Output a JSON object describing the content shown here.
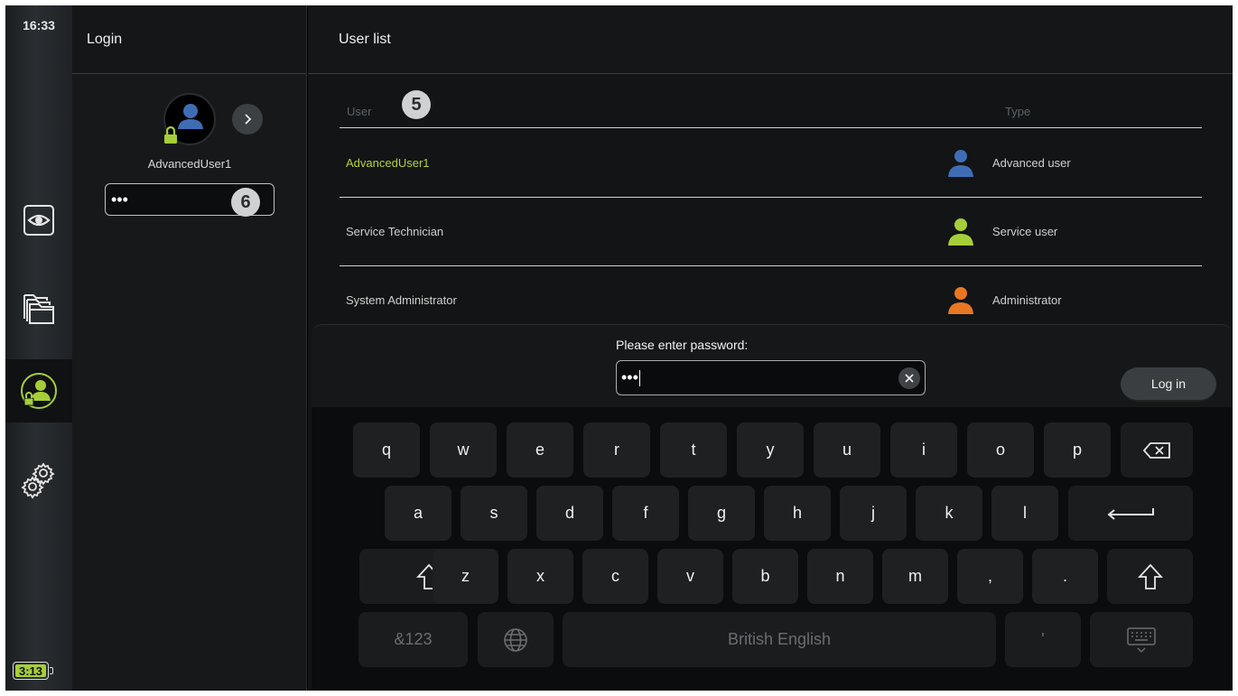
{
  "status": {
    "time": "16:33",
    "battery": "3:13"
  },
  "sidebar": {
    "items": [
      {
        "id": "eye",
        "icon": "eye-icon"
      },
      {
        "id": "folders",
        "icon": "folders-icon"
      },
      {
        "id": "login",
        "icon": "user-lock-icon",
        "active": true
      },
      {
        "id": "settings",
        "icon": "gears-icon"
      }
    ]
  },
  "login": {
    "title": "Login",
    "username": "AdvancedUser1",
    "password_mask": "•••",
    "callout": "6"
  },
  "user_list": {
    "title": "User list",
    "col_user": "User",
    "col_type": "Type",
    "callout": "5",
    "rows": [
      {
        "name": "AdvancedUser1",
        "type": "Advanced user",
        "icon_color": "#3f6db5",
        "selected": true
      },
      {
        "name": "Service Technician",
        "type": "Service user",
        "icon_color": "#a6ce39",
        "selected": false
      },
      {
        "name": "System Administrator",
        "type": "Administrator",
        "icon_color": "#e87722",
        "selected": false
      }
    ]
  },
  "keyboard": {
    "prompt": "Please enter password:",
    "password_mask": "•••",
    "login_label": "Log in",
    "row1": [
      "q",
      "w",
      "e",
      "r",
      "t",
      "y",
      "u",
      "i",
      "o",
      "p"
    ],
    "row2": [
      "a",
      "s",
      "d",
      "f",
      "g",
      "h",
      "j",
      "k",
      "l"
    ],
    "row3": [
      "z",
      "x",
      "c",
      "v",
      "b",
      "n",
      "m",
      ",",
      "."
    ],
    "symbols_label": "&123",
    "space_label": "British English",
    "apostrophe": "'"
  },
  "colors": {
    "accent": "#a6ce39",
    "advanced": "#3f6db5",
    "admin": "#e87722"
  }
}
